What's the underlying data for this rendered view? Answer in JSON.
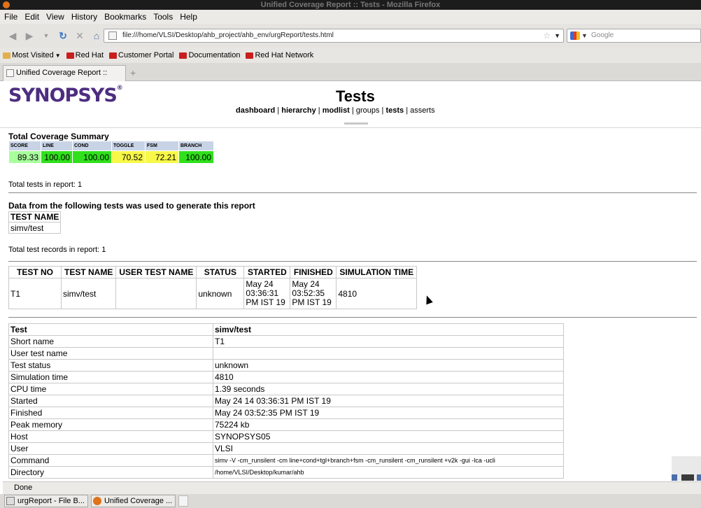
{
  "window": {
    "title": "Unified Coverage Report :: Tests - Mozilla Firefox"
  },
  "menu": [
    "File",
    "Edit",
    "View",
    "History",
    "Bookmarks",
    "Tools",
    "Help"
  ],
  "navbar": {
    "url": "file:///home/VLSI/Desktop/ahb_project/ahb_env/urgReport/tests.html",
    "search_placeholder": "Google"
  },
  "bookmarks": [
    "Most Visited",
    "Red Hat",
    "Customer Portal",
    "Documentation",
    "Red Hat Network"
  ],
  "tab": {
    "label": "Unified Coverage Report :: Tests",
    "new_tab": "+"
  },
  "page": {
    "logo": "SYNOPSYS",
    "logo_mark": "®",
    "title": "Tests",
    "nav": [
      {
        "label": "dashboard",
        "bold": true
      },
      {
        "label": "hierarchy",
        "bold": true
      },
      {
        "label": "modlist",
        "bold": true
      },
      {
        "label": "groups",
        "bold": false
      },
      {
        "label": "tests",
        "bold": true
      },
      {
        "label": "asserts",
        "bold": false
      }
    ],
    "nav_separator": " | "
  },
  "summary": {
    "title": "Total Coverage Summary",
    "headers": [
      "SCORE",
      "LINE",
      "COND",
      "TOGGLE",
      "FSM",
      "BRANCH"
    ],
    "values": [
      "89.33",
      "100.00",
      "100.00",
      "70.52",
      "72.21",
      "100.00"
    ],
    "colors": [
      "#a8ff9c",
      "#30e01c",
      "#30e01c",
      "#f8f848",
      "#f8f848",
      "#30e01c"
    ]
  },
  "total_tests": "Total tests in report: 1",
  "data_from": {
    "title": "Data from the following tests was used to generate this report",
    "header": "TEST NAME",
    "rows": [
      "simv/test"
    ]
  },
  "total_records": "Total test records in report: 1",
  "runs": {
    "headers": [
      "TEST NO",
      "TEST NAME",
      "USER TEST NAME",
      "STATUS",
      "STARTED",
      "FINISHED",
      "SIMULATION TIME"
    ],
    "row": {
      "test_no": "T1",
      "test_name": "simv/test",
      "user_test_name": "",
      "status": "unknown",
      "started": [
        "May 24",
        "03:36:31",
        "PM IST 19"
      ],
      "finished": [
        "May 24",
        "03:52:35",
        "PM IST 19"
      ],
      "sim_time": "4810"
    }
  },
  "detail": {
    "head": [
      "Test",
      "simv/test"
    ],
    "rows": [
      [
        "Short name",
        "T1"
      ],
      [
        "User test name",
        ""
      ],
      [
        "Test status",
        "unknown"
      ],
      [
        "Simulation time",
        "4810"
      ],
      [
        "CPU time",
        "1.39 seconds"
      ],
      [
        "Started",
        "May 24 14 03:36:31 PM IST 19"
      ],
      [
        "Finished",
        "May 24 03:52:35 PM IST 19"
      ],
      [
        "Peak memory",
        "75224 kb"
      ],
      [
        "Host",
        "SYNOPSYS05"
      ],
      [
        "User",
        "VLSI"
      ],
      [
        "Command",
        "simv -V -cm_runsilent -cm line+cond+tgl+branch+fsm -cm_runsilent -cm_runsilent +v2k -gui -lca -ucli"
      ],
      [
        "Directory",
        "/home/VLSI/Desktop/kumar/ahb"
      ]
    ]
  },
  "status": "Done",
  "taskbar": [
    "urgReport - File B...",
    "Unified Coverage ..."
  ]
}
